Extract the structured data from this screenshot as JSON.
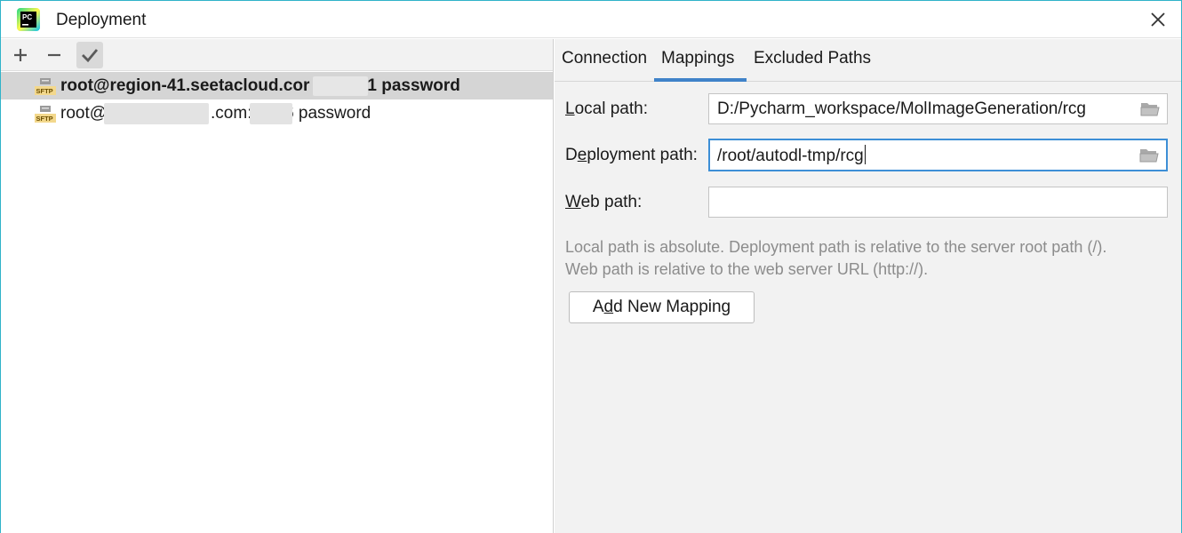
{
  "window": {
    "title": "Deployment",
    "app_icon_text": "PC"
  },
  "toolbar": {
    "add_icon": "plus-icon",
    "remove_icon": "minus-icon",
    "default_icon": "checkmark-icon"
  },
  "servers": [
    {
      "name": "root@region-41.seetacloud.cor",
      "suffix": "1 password",
      "type_label": "SFTP",
      "selected": true
    },
    {
      "name": "root@",
      "middle": ".com:4",
      "suffix": "6 password",
      "type_label": "SFTP",
      "selected": false
    }
  ],
  "tabs": [
    {
      "label": "Connection",
      "active": false
    },
    {
      "label": "Mappings",
      "active": true
    },
    {
      "label": "Excluded Paths",
      "active": false
    }
  ],
  "mappings": {
    "local_path": {
      "label_mnemonic": "L",
      "label_rest": "ocal path:",
      "value": "D:/Pycharm_workspace/MolImageGeneration/rcg"
    },
    "deployment_path": {
      "label_pre": "D",
      "label_mnemonic": "e",
      "label_rest": "ployment path:",
      "value": "/root/autodl-tmp/rcg"
    },
    "web_path": {
      "label_mnemonic": "W",
      "label_rest": "eb path:",
      "value": ""
    },
    "hint_line1": "Local path is absolute. Deployment path is relative to the server root path (/).",
    "hint_line2": "Web path is relative to the web server URL (http://).",
    "add_button": {
      "pre": "A",
      "mnemonic": "d",
      "rest": "d New Mapping"
    }
  },
  "colors": {
    "accent": "#4083c9",
    "focus_border": "#3d8fd6",
    "window_border": "#2fb3c9",
    "selection": "#d5d5d5",
    "hint_text": "#8c8c8c"
  }
}
